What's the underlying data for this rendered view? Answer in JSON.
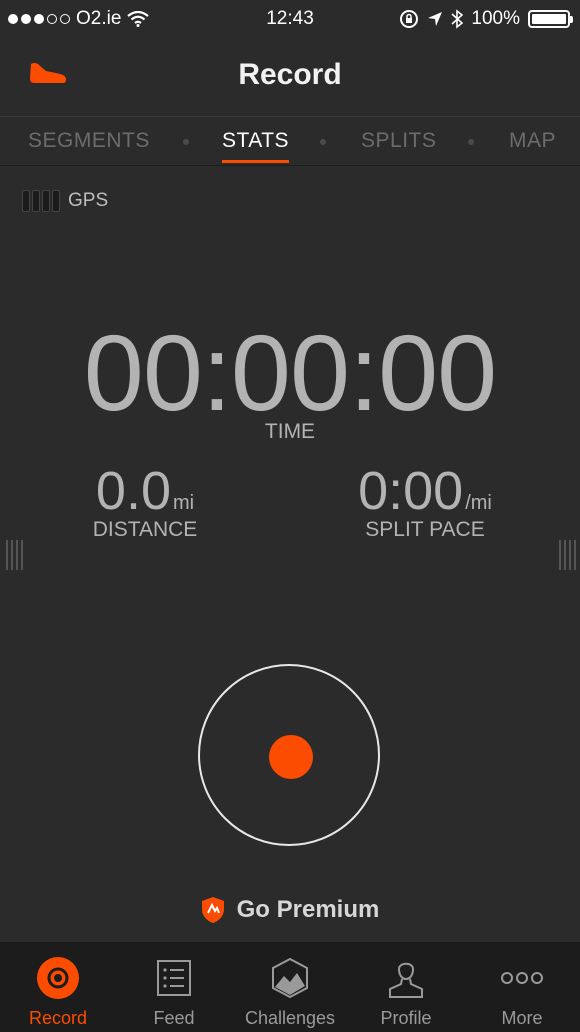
{
  "status_bar": {
    "carrier": "O2.ie",
    "time": "12:43",
    "battery": "100%"
  },
  "header": {
    "title": "Record",
    "shoe_icon": "shoe-icon"
  },
  "tabs": [
    {
      "label": "SEGMENTS"
    },
    {
      "label": "STATS"
    },
    {
      "label": "SPLITS"
    },
    {
      "label": "MAP"
    }
  ],
  "gps": {
    "label": "GPS"
  },
  "stats": {
    "time_value": "00:00:00",
    "time_label": "TIME",
    "distance_value": "0.0",
    "distance_unit": "mi",
    "distance_label": "DISTANCE",
    "pace_value": "0:00",
    "pace_unit": "/mi",
    "pace_label": "SPLIT PACE"
  },
  "premium": {
    "label": "Go Premium"
  },
  "tabbar": [
    {
      "label": "Record",
      "icon": "record-icon"
    },
    {
      "label": "Feed",
      "icon": "feed-icon"
    },
    {
      "label": "Challenges",
      "icon": "challenges-icon"
    },
    {
      "label": "Profile",
      "icon": "profile-icon"
    },
    {
      "label": "More",
      "icon": "more-icon"
    }
  ],
  "colors": {
    "accent": "#fc4c02",
    "background": "#2b2b2b",
    "tabbar": "#1c1c1c"
  }
}
